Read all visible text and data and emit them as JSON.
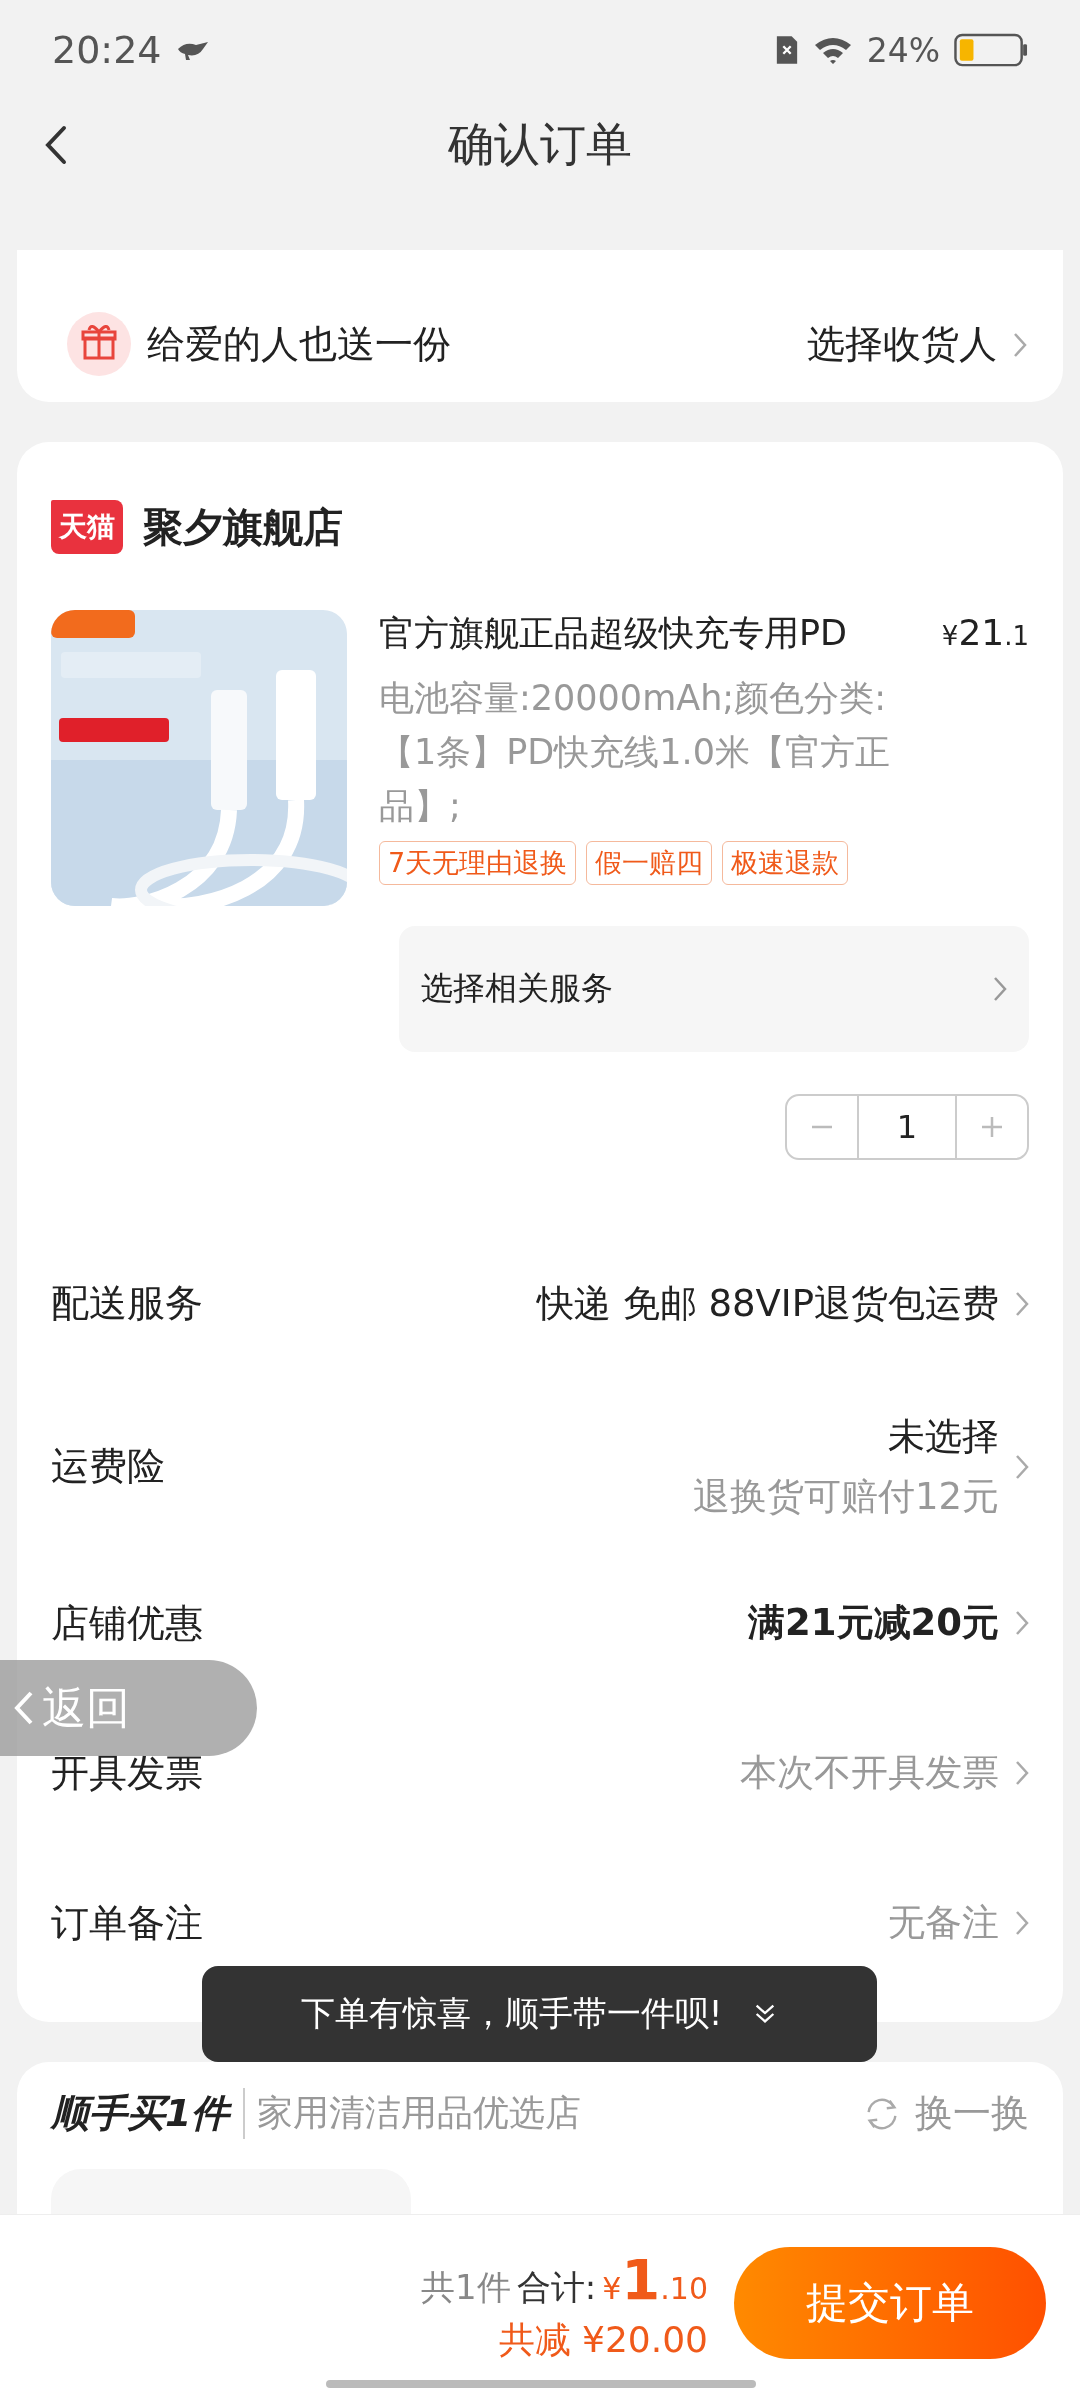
{
  "status_bar": {
    "time": "20:24",
    "battery": "24%"
  },
  "header": {
    "title": "确认订单"
  },
  "gift": {
    "text": "给爱的人也送一份",
    "action": "选择收货人"
  },
  "store": {
    "badge": "天猫",
    "name": "聚夕旗舰店"
  },
  "product": {
    "kind": "picture",
    "title": "官方旗舰正品超级快充专用PD",
    "price": {
      "symbol": "¥",
      "integer": "21",
      "decimal": ".1"
    },
    "spec": "电池容量:20000mAh;颜色分类:【1条】PD快充线1.0米【官方正品】;",
    "tags": [
      "7天无理由退换",
      "假一赔四",
      "极速退款"
    ],
    "service": "选择相关服务",
    "quantity": "1"
  },
  "rows": [
    {
      "label": "配送服务",
      "value": "快递 免邮 88VIP退货包运费",
      "kind": "normal"
    },
    {
      "label": "运费险",
      "value": "未选择",
      "sub": "退换货可赔付12元",
      "kind": "normal"
    },
    {
      "label": "店铺优惠",
      "value": "满21元减20元",
      "kind": "strong"
    },
    {
      "label": "开具发票",
      "value": "本次不开具发票",
      "kind": "muted"
    },
    {
      "label": "订单备注",
      "value": "无备注",
      "kind": "muted"
    }
  ],
  "float_back": {
    "label": "返回"
  },
  "toast": {
    "text": "下单有惊喜，顺手带一件呗!"
  },
  "recommend": {
    "title": "顺手买1件",
    "store": "家用清洁用品优选店",
    "refresh": "换一换"
  },
  "footer": {
    "count": "共1件",
    "total_label": "合计:",
    "total": {
      "symbol": "¥",
      "integer": "1",
      "decimal": ".10"
    },
    "discount": "共减 ¥20.00",
    "submit": "提交订单"
  }
}
